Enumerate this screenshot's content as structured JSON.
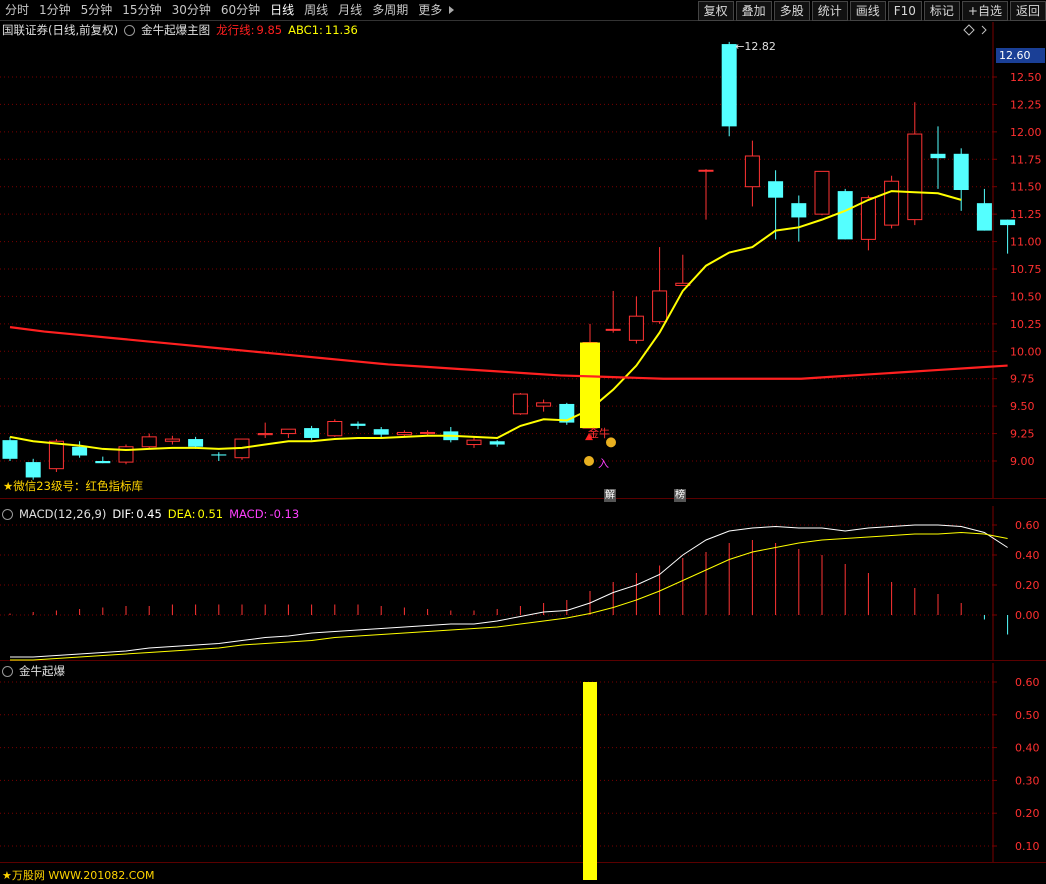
{
  "toolbar": {
    "periods": [
      "分时",
      "1分钟",
      "5分钟",
      "15分钟",
      "30分钟",
      "60分钟",
      "日线",
      "周线",
      "月线",
      "多周期",
      "更多"
    ],
    "active_period": "日线",
    "buttons": [
      "复权",
      "叠加",
      "多股",
      "统计",
      "画线",
      "F10",
      "标记",
      "+自选",
      "返回"
    ]
  },
  "main_panel": {
    "stock_title": "国联证券(日线,前复权)",
    "indicator_name": "金牛起爆主图",
    "dragon_label": "龙行线:",
    "dragon_value": "9.85",
    "abc_label": "ABC1:",
    "abc_value": "11.36",
    "current_price": "12.60",
    "high_label": "12.82",
    "y_ticks": [
      "12.50",
      "12.25",
      "12.00",
      "11.75",
      "11.50",
      "11.25",
      "11.00",
      "10.75",
      "10.50",
      "10.25",
      "10.00",
      "9.75",
      "9.50",
      "9.25",
      "9.00"
    ],
    "note": "★微信23级号：红色指标库",
    "signal_text1": "金牛",
    "signal_text2": "入",
    "mark1": "解",
    "mark2": "榜"
  },
  "macd_panel": {
    "title": "MACD(12,26,9)",
    "dif_label": "DIF:",
    "dif_value": "0.45",
    "dea_label": "DEA:",
    "dea_value": "0.51",
    "macd_label": "MACD:",
    "macd_value": "-0.13",
    "y_ticks": [
      "0.60",
      "0.40",
      "0.20",
      "0.00"
    ]
  },
  "bull_panel": {
    "title": "金牛起爆",
    "y_ticks": [
      "0.60",
      "0.50",
      "0.40",
      "0.30",
      "0.20",
      "0.10"
    ]
  },
  "footer": "★万股网 WWW.201082.COM",
  "colors": {
    "up": "#ff3333",
    "down": "#54ffff",
    "yellow": "#ffff00",
    "red_line": "#ff2020",
    "grid": "#7a0000"
  },
  "chart_data": {
    "type": "candlestick",
    "candles": [
      {
        "o": 9.19,
        "h": 9.22,
        "l": 9.0,
        "c": 9.02
      },
      {
        "o": 8.99,
        "h": 9.02,
        "l": 8.83,
        "c": 8.85
      },
      {
        "o": 8.93,
        "h": 9.2,
        "l": 8.9,
        "c": 9.18
      },
      {
        "o": 9.13,
        "h": 9.18,
        "l": 9.03,
        "c": 9.05
      },
      {
        "o": 9.0,
        "h": 9.04,
        "l": 8.98,
        "c": 8.98
      },
      {
        "o": 8.99,
        "h": 9.15,
        "l": 8.97,
        "c": 9.13
      },
      {
        "o": 9.13,
        "h": 9.25,
        "l": 9.11,
        "c": 9.22
      },
      {
        "o": 9.18,
        "h": 9.23,
        "l": 9.15,
        "c": 9.2
      },
      {
        "o": 9.2,
        "h": 9.22,
        "l": 9.11,
        "c": 9.13
      },
      {
        "o": 9.06,
        "h": 9.08,
        "l": 9.0,
        "c": 9.05
      },
      {
        "o": 9.03,
        "h": 9.2,
        "l": 9.01,
        "c": 9.2
      },
      {
        "o": 9.24,
        "h": 9.35,
        "l": 9.21,
        "c": 9.25
      },
      {
        "o": 9.25,
        "h": 9.29,
        "l": 9.21,
        "c": 9.29
      },
      {
        "o": 9.3,
        "h": 9.32,
        "l": 9.19,
        "c": 9.21
      },
      {
        "o": 9.23,
        "h": 9.38,
        "l": 9.22,
        "c": 9.36
      },
      {
        "o": 9.34,
        "h": 9.36,
        "l": 9.29,
        "c": 9.32
      },
      {
        "o": 9.29,
        "h": 9.31,
        "l": 9.21,
        "c": 9.24
      },
      {
        "o": 9.24,
        "h": 9.28,
        "l": 9.22,
        "c": 9.26
      },
      {
        "o": 9.25,
        "h": 9.28,
        "l": 9.23,
        "c": 9.26
      },
      {
        "o": 9.27,
        "h": 9.31,
        "l": 9.17,
        "c": 9.19
      },
      {
        "o": 9.15,
        "h": 9.22,
        "l": 9.12,
        "c": 9.19
      },
      {
        "o": 9.18,
        "h": 9.19,
        "l": 9.13,
        "c": 9.15
      },
      {
        "o": 9.43,
        "h": 9.62,
        "l": 9.42,
        "c": 9.61
      },
      {
        "o": 9.5,
        "h": 9.56,
        "l": 9.45,
        "c": 9.53
      },
      {
        "o": 9.52,
        "h": 9.53,
        "l": 9.33,
        "c": 9.35
      },
      {
        "o": 9.3,
        "h": 10.25,
        "l": 9.3,
        "c": 10.08
      },
      {
        "o": 10.2,
        "h": 10.55,
        "l": 10.17,
        "c": 10.2
      },
      {
        "o": 10.1,
        "h": 10.5,
        "l": 10.07,
        "c": 10.32
      },
      {
        "o": 10.27,
        "h": 10.95,
        "l": 10.25,
        "c": 10.55
      },
      {
        "o": 10.6,
        "h": 10.88,
        "l": 10.6,
        "c": 10.62
      },
      {
        "o": 11.65,
        "h": 11.66,
        "l": 11.2,
        "c": 11.65
      },
      {
        "o": 12.8,
        "h": 12.82,
        "l": 11.96,
        "c": 12.05
      },
      {
        "o": 11.5,
        "h": 11.92,
        "l": 11.32,
        "c": 11.78
      },
      {
        "o": 11.55,
        "h": 11.65,
        "l": 11.02,
        "c": 11.4
      },
      {
        "o": 11.35,
        "h": 11.42,
        "l": 11.0,
        "c": 11.22
      },
      {
        "o": 11.25,
        "h": 11.64,
        "l": 11.24,
        "c": 11.64
      },
      {
        "o": 11.46,
        "h": 11.48,
        "l": 11.02,
        "c": 11.02
      },
      {
        "o": 11.02,
        "h": 11.42,
        "l": 10.92,
        "c": 11.4
      },
      {
        "o": 11.15,
        "h": 11.6,
        "l": 11.12,
        "c": 11.55
      },
      {
        "o": 11.2,
        "h": 12.27,
        "l": 11.15,
        "c": 11.98
      },
      {
        "o": 11.8,
        "h": 12.05,
        "l": 11.48,
        "c": 11.76
      },
      {
        "o": 11.8,
        "h": 11.85,
        "l": 11.28,
        "c": 11.47
      },
      {
        "o": 11.35,
        "h": 11.48,
        "l": 11.1,
        "c": 11.1
      },
      {
        "o": 11.2,
        "h": 11.2,
        "l": 10.89,
        "c": 11.15
      }
    ],
    "abc1_line": [
      9.22,
      9.18,
      9.16,
      9.14,
      9.11,
      9.1,
      9.11,
      9.12,
      9.12,
      9.11,
      9.12,
      9.15,
      9.18,
      9.18,
      9.2,
      9.21,
      9.21,
      9.22,
      9.23,
      9.23,
      9.22,
      9.21,
      9.32,
      9.38,
      9.37,
      9.47,
      9.65,
      9.87,
      10.17,
      10.55,
      10.78,
      10.9,
      10.95,
      11.1,
      11.13,
      11.2,
      11.28,
      11.38,
      11.46,
      11.45,
      11.44,
      11.38
    ],
    "dragon_line": [
      10.22,
      10.18,
      10.15,
      10.12,
      10.09,
      10.06,
      10.03,
      10.0,
      9.97,
      9.94,
      9.91,
      9.88,
      9.86,
      9.84,
      9.82,
      9.8,
      9.78,
      9.77,
      9.76,
      9.75,
      9.75,
      9.75,
      9.75,
      9.75,
      9.77,
      9.79,
      9.81,
      9.83,
      9.85,
      9.87
    ],
    "macd_bars": [
      0.01,
      0.02,
      0.03,
      0.04,
      0.05,
      0.06,
      0.06,
      0.07,
      0.07,
      0.07,
      0.07,
      0.07,
      0.07,
      0.07,
      0.07,
      0.07,
      0.06,
      0.05,
      0.04,
      0.03,
      0.03,
      0.04,
      0.06,
      0.08,
      0.1,
      0.16,
      0.22,
      0.28,
      0.33,
      0.38,
      0.42,
      0.48,
      0.5,
      0.48,
      0.44,
      0.4,
      0.34,
      0.28,
      0.22,
      0.18,
      0.14,
      0.08,
      -0.03,
      -0.13
    ],
    "dif": [
      -0.28,
      -0.28,
      -0.27,
      -0.26,
      -0.25,
      -0.24,
      -0.22,
      -0.21,
      -0.2,
      -0.19,
      -0.17,
      -0.15,
      -0.14,
      -0.12,
      -0.11,
      -0.1,
      -0.09,
      -0.08,
      -0.07,
      -0.06,
      -0.06,
      -0.04,
      -0.01,
      0.02,
      0.03,
      0.08,
      0.15,
      0.2,
      0.27,
      0.4,
      0.5,
      0.56,
      0.58,
      0.59,
      0.58,
      0.58,
      0.56,
      0.58,
      0.59,
      0.6,
      0.6,
      0.59,
      0.55,
      0.45
    ],
    "dea": [
      -0.3,
      -0.3,
      -0.29,
      -0.28,
      -0.27,
      -0.26,
      -0.25,
      -0.24,
      -0.23,
      -0.22,
      -0.2,
      -0.19,
      -0.18,
      -0.17,
      -0.15,
      -0.14,
      -0.13,
      -0.12,
      -0.11,
      -0.1,
      -0.09,
      -0.08,
      -0.06,
      -0.04,
      -0.02,
      0.01,
      0.05,
      0.1,
      0.16,
      0.23,
      0.3,
      0.37,
      0.42,
      0.45,
      0.48,
      0.5,
      0.51,
      0.52,
      0.53,
      0.54,
      0.54,
      0.55,
      0.54,
      0.51
    ],
    "bull_bar": {
      "index": 25,
      "value": 0.6
    }
  }
}
